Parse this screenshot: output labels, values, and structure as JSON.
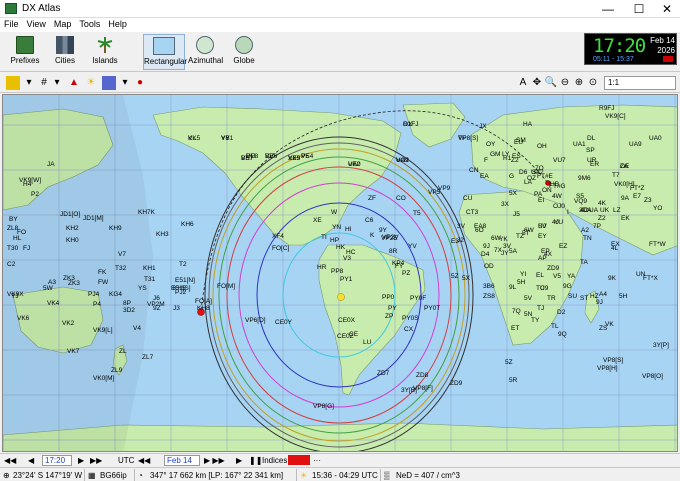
{
  "window": {
    "title": "DX Atlas",
    "minimize": "—",
    "maximize": "☐",
    "close": "✕"
  },
  "menu": [
    "File",
    "View",
    "Map",
    "Tools",
    "Help"
  ],
  "toolbar": {
    "prefixes": "Prefixes",
    "cities": "Cities",
    "islands": "Islands",
    "rectangular": "Rectangular",
    "azimuthal": "Azimuthal",
    "globe": "Globe"
  },
  "clock": {
    "time": "17:20",
    "date_line1": "Feb 14",
    "date_line2": "2026",
    "sun_times": "05:11 - 15:37"
  },
  "toolbar2": {
    "zoom_value": "1:1"
  },
  "map": {
    "ocean_color": "#a8d4f4",
    "land_color": "#c8ecae",
    "grid_color": "#8aa0c8",
    "labels": [
      {
        "t": "KL"
      },
      {
        "t": "VY1"
      },
      {
        "t": "VE8"
      },
      {
        "t": "VE7"
      },
      {
        "t": "VE6"
      },
      {
        "t": "VE5"
      },
      {
        "t": "VE4"
      },
      {
        "t": "VE2"
      },
      {
        "t": "VO2"
      },
      {
        "t": "OX"
      },
      {
        "t": "TF"
      },
      {
        "t": "JX"
      },
      {
        "t": "OY"
      },
      {
        "t": "GM"
      },
      {
        "t": "SM"
      },
      {
        "t": "OH"
      },
      {
        "t": "UA1"
      },
      {
        "t": "UA9"
      },
      {
        "t": "UA0"
      },
      {
        "t": "R9FJ"
      },
      {
        "t": "JA"
      },
      {
        "t": "BY"
      },
      {
        "t": "HL"
      },
      {
        "t": "JD1[O]"
      },
      {
        "t": "JD1[M]"
      },
      {
        "t": "KH9"
      },
      {
        "t": "KH7K"
      },
      {
        "t": "KH2"
      },
      {
        "t": "KH0"
      },
      {
        "t": "KH3"
      },
      {
        "t": "KH6"
      },
      {
        "t": "V7"
      },
      {
        "t": "T32"
      },
      {
        "t": "T31"
      },
      {
        "t": "KH1"
      },
      {
        "t": "KH5"
      },
      {
        "t": "T2"
      },
      {
        "t": "3D2"
      },
      {
        "t": "ZK3"
      },
      {
        "t": "VK9X"
      },
      {
        "t": "VK6"
      },
      {
        "t": "VK2"
      },
      {
        "t": "VK4"
      },
      {
        "t": "VK7"
      },
      {
        "t": "ZL"
      },
      {
        "t": "ZL7"
      },
      {
        "t": "ZL9"
      },
      {
        "t": "VK0[M]"
      },
      {
        "t": "VK9[L]"
      },
      {
        "t": "E51[N]"
      },
      {
        "t": "E51[S]"
      },
      {
        "t": "FO[M]"
      },
      {
        "t": "FO[A]"
      },
      {
        "t": "FO[C]"
      },
      {
        "t": "XF4"
      },
      {
        "t": "VP6[D]"
      },
      {
        "t": "CE0Y"
      },
      {
        "t": "CE0X"
      },
      {
        "t": "CE0Z"
      },
      {
        "t": "CE"
      },
      {
        "t": "LU"
      },
      {
        "t": "CX"
      },
      {
        "t": "ZP"
      },
      {
        "t": "PY"
      },
      {
        "t": "PY0T"
      },
      {
        "t": "PY0F"
      },
      {
        "t": "PY0S"
      },
      {
        "t": "PP0"
      },
      {
        "t": "PY1"
      },
      {
        "t": "PP8"
      },
      {
        "t": "HC"
      },
      {
        "t": "HK"
      },
      {
        "t": "HP"
      },
      {
        "t": "TI"
      },
      {
        "t": "YN"
      },
      {
        "t": "HR"
      },
      {
        "t": "XE"
      },
      {
        "t": "W"
      },
      {
        "t": "K"
      },
      {
        "t": "VP2E"
      },
      {
        "t": "KP4"
      },
      {
        "t": "FY"
      },
      {
        "t": "PZ"
      },
      {
        "t": "8R"
      },
      {
        "t": "YV"
      },
      {
        "t": "9Y"
      },
      {
        "t": "HI"
      },
      {
        "t": "C6"
      },
      {
        "t": "CO"
      },
      {
        "t": "VP9"
      },
      {
        "t": "CU"
      },
      {
        "t": "CT3"
      },
      {
        "t": "EA8"
      },
      {
        "t": "D4"
      },
      {
        "t": "6W"
      },
      {
        "t": "3V"
      },
      {
        "t": "CN"
      },
      {
        "t": "EA"
      },
      {
        "t": "F"
      },
      {
        "t": "G"
      },
      {
        "t": "EI"
      },
      {
        "t": "I"
      },
      {
        "t": "SV"
      },
      {
        "t": "TA"
      },
      {
        "t": "4X"
      },
      {
        "t": "SU"
      },
      {
        "t": "ST"
      },
      {
        "t": "ET"
      },
      {
        "t": "5Z"
      },
      {
        "t": "5H"
      },
      {
        "t": "9J"
      },
      {
        "t": "ZS"
      },
      {
        "t": "ZS8"
      },
      {
        "t": "3B6"
      },
      {
        "t": "5R"
      },
      {
        "t": "ZD7"
      },
      {
        "t": "ZD8"
      },
      {
        "t": "ZD9"
      },
      {
        "t": "3Y[B]"
      },
      {
        "t": "VP8[F]"
      },
      {
        "t": "VP8[G]"
      },
      {
        "t": "VP8[S]"
      },
      {
        "t": "VP8[H]"
      },
      {
        "t": "VP8[O]"
      },
      {
        "t": "3Y[P]"
      },
      {
        "t": "FT*X"
      },
      {
        "t": "FT*W"
      },
      {
        "t": "VK0[H]"
      },
      {
        "t": "FT*Z"
      },
      {
        "t": "VQ9"
      },
      {
        "t": "YU"
      },
      {
        "t": "UK"
      },
      {
        "t": "EX"
      },
      {
        "t": "4L"
      },
      {
        "t": "EK"
      },
      {
        "t": "UN"
      },
      {
        "t": "9K"
      },
      {
        "t": "A4"
      },
      {
        "t": "HZ"
      },
      {
        "t": "4W"
      },
      {
        "t": "9M6"
      },
      {
        "t": "VU7"
      },
      {
        "t": "7O"
      },
      {
        "t": "S7"
      },
      {
        "t": "D6"
      },
      {
        "t": "FT#G"
      },
      {
        "t": "FT#E"
      },
      {
        "t": "5X"
      },
      {
        "t": "ER"
      },
      {
        "t": "UR"
      },
      {
        "t": "SP"
      },
      {
        "t": "DL"
      },
      {
        "t": "ZA"
      },
      {
        "t": "OE"
      },
      {
        "t": "HA"
      },
      {
        "t": "EU"
      },
      {
        "t": "LY"
      },
      {
        "t": "ES"
      },
      {
        "t": "R1"
      },
      {
        "t": "Z2"
      },
      {
        "t": "OJ0"
      },
      {
        "t": "UA2"
      },
      {
        "t": "LA"
      },
      {
        "t": "OZ"
      },
      {
        "t": "PA"
      },
      {
        "t": "ON"
      },
      {
        "t": "HB"
      },
      {
        "t": "T7"
      },
      {
        "t": "9A"
      },
      {
        "t": "S5"
      },
      {
        "t": "E7"
      },
      {
        "t": "Z3"
      },
      {
        "t": "YO"
      },
      {
        "t": "LZ"
      },
      {
        "t": "4O"
      },
      {
        "t": "UA"
      },
      {
        "t": "4K"
      },
      {
        "t": "4J"
      },
      {
        "t": "UJ"
      },
      {
        "t": "EY"
      },
      {
        "t": "EZ"
      },
      {
        "t": "EP"
      },
      {
        "t": "YA"
      },
      {
        "t": "AP"
      },
      {
        "t": "YI"
      },
      {
        "t": "OD"
      },
      {
        "t": "YK"
      },
      {
        "t": "JY"
      },
      {
        "t": "5A"
      },
      {
        "t": "3V"
      },
      {
        "t": "7X"
      },
      {
        "t": "TZ"
      },
      {
        "t": "5T"
      },
      {
        "t": "6W"
      },
      {
        "t": "J5"
      },
      {
        "t": "3X"
      },
      {
        "t": "9L"
      },
      {
        "t": "EL"
      },
      {
        "t": "TU"
      },
      {
        "t": "9G"
      },
      {
        "t": "5V"
      },
      {
        "t": "TY"
      },
      {
        "t": "5N"
      },
      {
        "t": "TJ"
      },
      {
        "t": "TL"
      },
      {
        "t": "D2"
      },
      {
        "t": "TN"
      },
      {
        "t": "TR"
      },
      {
        "t": "9Q"
      },
      {
        "t": "ZD9"
      },
      {
        "t": "7Q"
      },
      {
        "t": "C9"
      },
      {
        "t": "A2"
      },
      {
        "t": "V5"
      },
      {
        "t": "3DA"
      },
      {
        "t": "7P"
      },
      {
        "t": "Z2"
      },
      {
        "t": "9J"
      },
      {
        "t": "5H"
      },
      {
        "t": "5X"
      },
      {
        "t": "5Z"
      },
      {
        "t": "6O"
      },
      {
        "t": "E3"
      },
      {
        "t": "J2"
      },
      {
        "t": "T5"
      },
      {
        "t": "ZF"
      },
      {
        "t": "V3"
      },
      {
        "t": "VP5"
      },
      {
        "t": "VP2V"
      },
      {
        "t": "J6"
      },
      {
        "t": "8P"
      },
      {
        "t": "J3"
      },
      {
        "t": "9Z"
      },
      {
        "t": "PJ2"
      },
      {
        "t": "PJ4"
      },
      {
        "t": "P4"
      },
      {
        "t": "YS"
      },
      {
        "t": "KG4"
      },
      {
        "t": "VP2M"
      },
      {
        "t": "V4"
      },
      {
        "t": "KH8"
      },
      {
        "t": "ZK3"
      },
      {
        "t": "YJ"
      },
      {
        "t": "FK"
      },
      {
        "t": "FW"
      },
      {
        "t": "5W"
      },
      {
        "t": "A3"
      },
      {
        "t": "C2"
      },
      {
        "t": "T30"
      },
      {
        "t": "FJ"
      },
      {
        "t": "ZL8"
      },
      {
        "t": "FO"
      },
      {
        "t": "P2"
      },
      {
        "t": "H4"
      },
      {
        "t": "VK9[W]"
      },
      {
        "t": "VK9[C]"
      },
      {
        "t": "VK"
      },
      {
        "t": "VK5"
      },
      {
        "t": "YB"
      },
      {
        "t": "DU"
      },
      {
        "t": "BS7"
      },
      {
        "t": "BV"
      },
      {
        "t": "XX9"
      },
      {
        "t": "P5"
      },
      {
        "t": "UA0"
      },
      {
        "t": "UA9"
      },
      {
        "t": "R1FJ"
      },
      {
        "t": "VP8[S]"
      }
    ]
  },
  "navbar": {
    "time": "17:20",
    "utc": "UTC",
    "date": "Feb 14",
    "indices": "Indices:"
  },
  "status": {
    "coords": "23°24' S  147°19' W",
    "grid": "BG66ip",
    "bearing": "347°  17 662 km   [LP: 167°  22 341 km]",
    "sun": "15:36 - 04:29 UTC",
    "ionosphere": "NeD = 407 / cm^3"
  }
}
